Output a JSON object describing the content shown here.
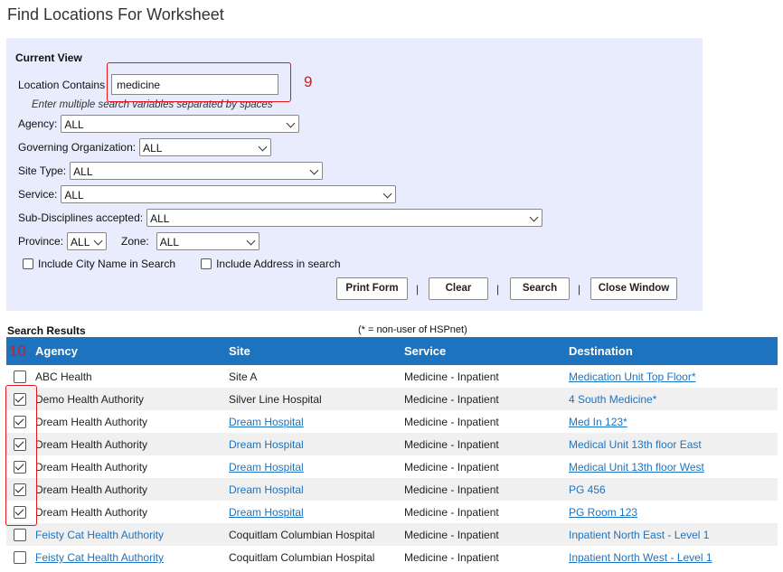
{
  "page_title": "Find Locations For Worksheet",
  "form": {
    "section_title": "Current View",
    "location_label": "Location Contains",
    "location_value": "medicine",
    "location_hint": "Enter multiple search variables separated by spaces",
    "agency_label": "Agency:",
    "agency_value": "ALL",
    "gov_org_label": "Governing Organization:",
    "gov_org_value": "ALL",
    "site_type_label": "Site Type:",
    "site_type_value": "ALL",
    "service_label": "Service:",
    "service_value": "ALL",
    "subdisc_label": "Sub-Disciplines accepted:",
    "subdisc_value": "ALL",
    "province_label": "Province:",
    "province_value": "ALL",
    "zone_label": "Zone:",
    "zone_value": "ALL",
    "include_city_label": "Include City Name in Search",
    "include_city_checked": false,
    "include_address_label": "Include Address in search",
    "include_address_checked": false,
    "buttons": {
      "print": "Print Form",
      "clear": "Clear",
      "search": "Search",
      "close": "Close Window"
    },
    "separator": "|"
  },
  "annotations": {
    "first": "9",
    "second": "10"
  },
  "results": {
    "label": "Search Results",
    "note": "(* = non-user of HSPnet)",
    "columns": [
      "Agency",
      "Site",
      "Service",
      "Destination"
    ],
    "rows": [
      {
        "checked": false,
        "agency": "ABC Health",
        "agency_link": false,
        "site": "Site A",
        "site_link": false,
        "service": "Medicine - Inpatient",
        "destination": "Medication Unit Top Floor*",
        "dest_underline": true
      },
      {
        "checked": true,
        "agency": "Demo Health Authority",
        "agency_link": false,
        "site": "Silver Line Hospital",
        "site_link": false,
        "service": "Medicine - Inpatient",
        "destination": "4 South Medicine*",
        "dest_underline": false
      },
      {
        "checked": true,
        "agency": "Dream Health Authority",
        "agency_link": false,
        "site": "Dream Hospital",
        "site_link": true,
        "service": "Medicine - Inpatient",
        "destination": "Med In 123*",
        "dest_underline": true
      },
      {
        "checked": true,
        "agency": "Dream Health Authority",
        "agency_link": false,
        "site": "Dream Hospital",
        "site_link": false,
        "service": "Medicine - Inpatient",
        "destination": "Medical Unit 13th floor East",
        "dest_underline": false
      },
      {
        "checked": true,
        "agency": "Dream Health Authority",
        "agency_link": false,
        "site": "Dream Hospital",
        "site_link": true,
        "service": "Medicine - Inpatient",
        "destination": "Medical Unit 13th floor West",
        "dest_underline": true
      },
      {
        "checked": true,
        "agency": "Dream Health Authority",
        "agency_link": false,
        "site": "Dream Hospital",
        "site_link": false,
        "service": "Medicine - Inpatient",
        "destination": "PG 456",
        "dest_underline": false
      },
      {
        "checked": true,
        "agency": "Dream Health Authority",
        "agency_link": false,
        "site": "Dream Hospital",
        "site_link": true,
        "service": "Medicine - Inpatient",
        "destination": "PG Room 123",
        "dest_underline": true
      },
      {
        "checked": false,
        "agency": "Feisty Cat Health Authority",
        "agency_link": false,
        "site": "Coquitlam Columbian Hospital",
        "site_link": false,
        "service": "Medicine - Inpatient",
        "destination": "Inpatient North East - Level 1",
        "dest_underline": false
      },
      {
        "checked": false,
        "agency": "Feisty Cat Health Authority",
        "agency_link": true,
        "site": "Coquitlam Columbian Hospital",
        "site_link": false,
        "service": "Medicine - Inpatient",
        "destination": "Inpatient North West - Level 1",
        "dest_underline": true
      }
    ]
  },
  "colors": {
    "panel_bg": "#e8ecfc",
    "header_bg": "#1e73be",
    "link": "#1e73be",
    "annotation": "#e0161b"
  }
}
